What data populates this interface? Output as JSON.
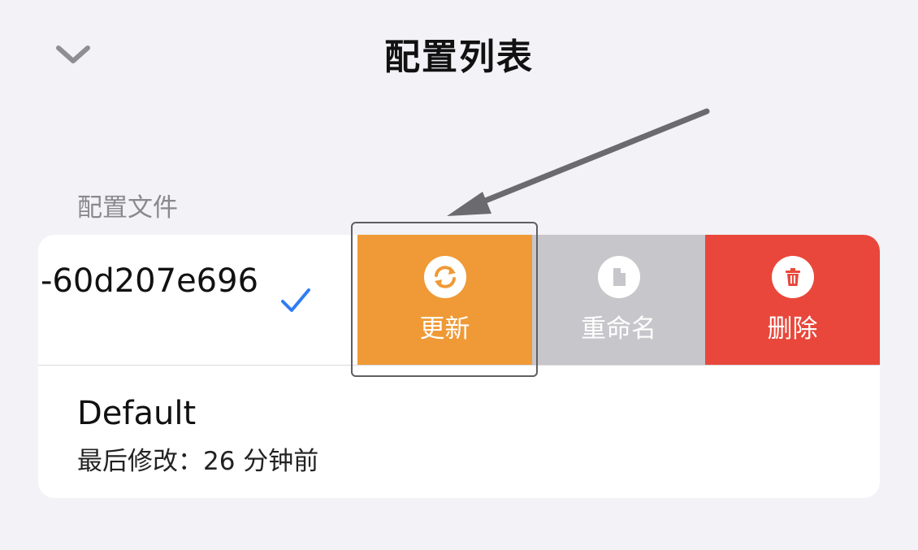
{
  "nav": {
    "title": "配置列表",
    "back_icon": "chevron-down-icon"
  },
  "section": {
    "header": "配置文件"
  },
  "profiles": [
    {
      "name": "-60d207e696",
      "selected": true,
      "actions": [
        {
          "label": "更新",
          "icon": "refresh-icon",
          "color": "#ef9a36"
        },
        {
          "label": "重命名",
          "icon": "document-icon",
          "color": "#c6c6cb"
        },
        {
          "label": "删除",
          "icon": "trash-icon",
          "color": "#e9473b"
        }
      ]
    },
    {
      "name": "Default",
      "subtitle": "最后修改：26 分钟前"
    }
  ],
  "colors": {
    "background": "#f2f2f7",
    "accent": "#2f7cf6"
  }
}
